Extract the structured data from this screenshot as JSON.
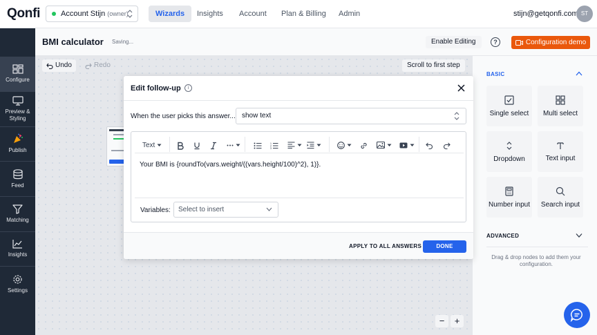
{
  "app": {
    "logo": "Qonfi"
  },
  "account": {
    "name": "Account Stijn",
    "role": "(owner)"
  },
  "nav": {
    "tabs": [
      "Wizards",
      "Insights",
      "Account",
      "Plan & Billing",
      "Admin"
    ],
    "active": "Wizards"
  },
  "user": {
    "email": "stijn@getqonfi.com",
    "initials": "ST"
  },
  "sidebar": {
    "items": [
      {
        "label": "Configure",
        "icon": "configure-icon"
      },
      {
        "label": "Preview &\nStyling",
        "icon": "monitor-icon"
      },
      {
        "label": "Publish",
        "icon": "party-popper-icon"
      },
      {
        "label": "Feed",
        "icon": "database-icon"
      },
      {
        "label": "Matching",
        "icon": "filter-icon"
      },
      {
        "label": "Insights",
        "icon": "chart-icon"
      },
      {
        "label": "Settings",
        "icon": "gear-icon"
      }
    ],
    "active": "Configure"
  },
  "header": {
    "title": "BMI calculator",
    "status": "Saving...",
    "enable_editing": "Enable Editing",
    "help": "?",
    "demo": "Configuration demo"
  },
  "canvas": {
    "undo": "Undo",
    "redo": "Redo",
    "scroll_first": "Scroll to first step",
    "zoom_out": "−",
    "zoom_in": "+"
  },
  "modal": {
    "title": "Edit follow-up",
    "info": "i",
    "question_label": "When the user picks this answer...",
    "action_value": "show text",
    "toolbar": {
      "text_style": "Text"
    },
    "content": "Your BMI is {roundTo(vars.weight/((vars.height/100)^2), 1)}.",
    "variables_label": "Variables:",
    "variables_placeholder": "Select to insert",
    "apply_all": "APPLY TO ALL ANSWERS",
    "done": "DONE"
  },
  "right_panel": {
    "basic_heading": "BASIC",
    "tiles": [
      {
        "label": "Single select",
        "icon": "checkbox-icon"
      },
      {
        "label": "Multi select",
        "icon": "grid-icon"
      },
      {
        "label": "Dropdown",
        "icon": "updown-icon"
      },
      {
        "label": "Text input",
        "icon": "text-icon"
      },
      {
        "label": "Number input",
        "icon": "calculator-icon"
      },
      {
        "label": "Search input",
        "icon": "search-icon"
      }
    ],
    "advanced_heading": "ADVANCED",
    "hint": "Drag & drop nodes to add them your configuration."
  },
  "colors": {
    "accent": "#2563eb",
    "brand_orange": "#ea580c",
    "sidebar": "#1f2937",
    "status_green": "#22c55e"
  }
}
